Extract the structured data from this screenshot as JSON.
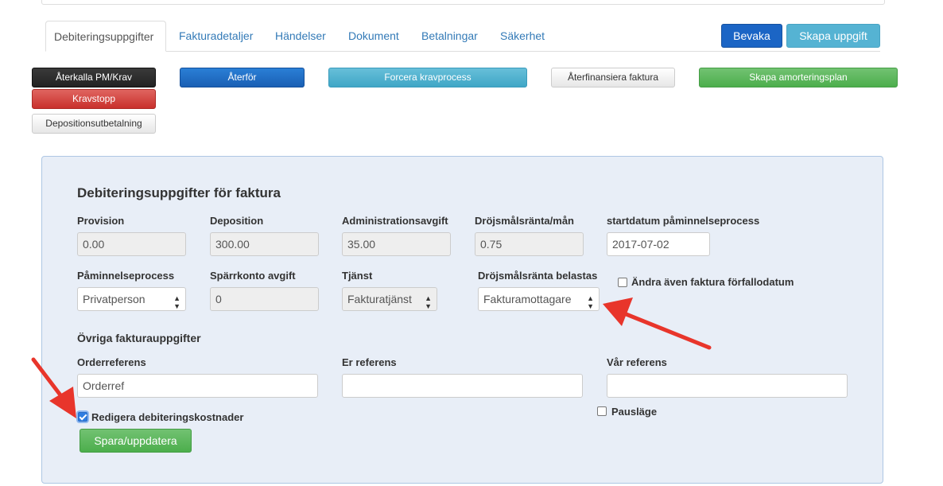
{
  "tabs": [
    {
      "label": "Debiteringsuppgifter",
      "active": true
    },
    {
      "label": "Fakturadetaljer"
    },
    {
      "label": "Händelser"
    },
    {
      "label": "Dokument"
    },
    {
      "label": "Betalningar"
    },
    {
      "label": "Säkerhet"
    }
  ],
  "header_buttons": {
    "watch": "Bevaka",
    "create_task": "Skapa uppgift"
  },
  "actions": {
    "recall": "Återkalla PM/Krav",
    "stop": "Kravstopp",
    "deposit_payout": "Depositionsutbetalning",
    "reverse": "Återför",
    "force": "Forcera kravprocess",
    "refinance": "Återfinansiera faktura",
    "amortization": "Skapa amorteringsplan"
  },
  "panel": {
    "title": "Debiteringsuppgifter för faktura",
    "fields": {
      "provision": {
        "label": "Provision",
        "value": "0.00"
      },
      "deposition": {
        "label": "Deposition",
        "value": "300.00"
      },
      "admin_fee": {
        "label": "Administrationsavgift",
        "value": "35.00"
      },
      "late_interest": {
        "label": "Dröjsmålsränta/mån",
        "value": "0.75"
      },
      "reminder_start": {
        "label": "startdatum påminnelseprocess",
        "value": "2017-07-02"
      },
      "reminder_process": {
        "label": "Påminnelseprocess",
        "value": "Privatperson"
      },
      "escrow_fee": {
        "label": "Spärrkonto avgift",
        "value": "0"
      },
      "service": {
        "label": "Tjänst",
        "value": "Fakturatjänst"
      },
      "interest_charged": {
        "label": "Dröjsmålsränta belastas",
        "value": "Fakturamottagare"
      },
      "change_due_date": {
        "label": "Ändra även faktura förfallodatum",
        "checked": false
      }
    },
    "other_title": "Övriga fakturauppgifter",
    "order_ref": {
      "label": "Orderreferens",
      "value": "Orderref"
    },
    "their_ref": {
      "label": "Er referens",
      "value": ""
    },
    "our_ref": {
      "label": "Vår referens",
      "value": ""
    },
    "edit_costs": {
      "label": "Redigera debiteringskostnader",
      "checked": true
    },
    "pause": {
      "label": "Pausläge",
      "checked": false
    },
    "save": "Spara/uppdatera"
  },
  "colors": {
    "annotation_arrow": "#e8352b",
    "panel_bg": "#e8eef7"
  }
}
